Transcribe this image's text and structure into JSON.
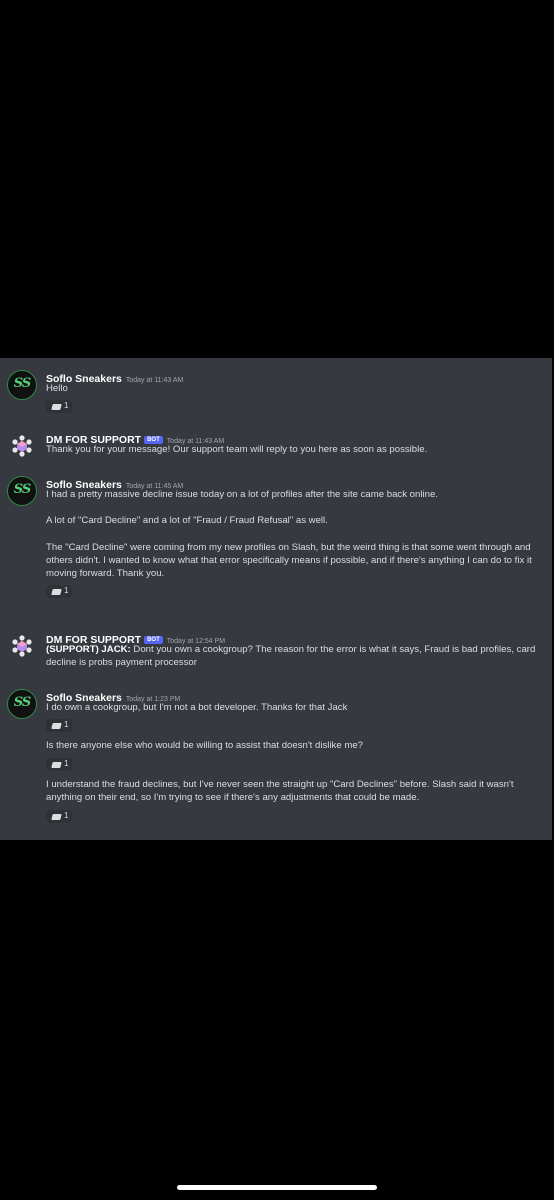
{
  "messages": [
    {
      "author": "Soflo Sneakers",
      "bot": false,
      "timestamp": "Today at 11:43 AM",
      "avatar_icon": "soflo-ss-logo",
      "paragraphs": [
        {
          "text": "Hello",
          "reaction": {
            "emoji": "ticket-icon",
            "count": "1"
          }
        }
      ]
    },
    {
      "author": "DM FOR SUPPORT",
      "bot": true,
      "badge": "BOT",
      "timestamp": "Today at 11:43 AM",
      "avatar_icon": "bot-cube-logo",
      "paragraphs": [
        {
          "text": "Thank you for your message! Our support team will reply to you here as soon as possible."
        }
      ]
    },
    {
      "author": "Soflo Sneakers",
      "bot": false,
      "timestamp": "Today at 11:45 AM",
      "avatar_icon": "soflo-ss-logo",
      "paragraphs": [
        {
          "text": "I had a pretty massive decline issue today on a lot of profiles after the site came back online."
        },
        {
          "text": "A lot of \"Card Decline\" and a lot of \"Fraud / Fraud Refusal\" as well."
        },
        {
          "text": "The \"Card Decline\" were coming from my new profiles on Slash, but the weird thing is that some went through and others didn't. I wanted to know what that error specifically means if possible, and if there's anything I can do to fix it moving forward. Thank you.",
          "reaction": {
            "emoji": "ticket-icon",
            "count": "1"
          }
        }
      ]
    },
    {
      "author": "DM FOR SUPPORT",
      "bot": true,
      "badge": "BOT",
      "timestamp": "Today at 12:54 PM",
      "avatar_icon": "bot-cube-logo",
      "paragraphs": [
        {
          "bold_prefix": "(SUPPORT) JACK:",
          "text": " Dont you own a cookgroup? The reason for the error is what it says, Fraud is bad profiles, card decline is probs payment processor"
        }
      ]
    },
    {
      "author": "Soflo Sneakers",
      "bot": false,
      "timestamp": "Today at 1:23 PM",
      "avatar_icon": "soflo-ss-logo",
      "paragraphs": [
        {
          "text": "I do own a cookgroup, but I'm not a bot developer. Thanks for that Jack",
          "reaction": {
            "emoji": "ticket-icon",
            "count": "1"
          }
        },
        {
          "text": "Is there anyone else who would be willing to assist that doesn't dislike me?",
          "reaction": {
            "emoji": "ticket-icon",
            "count": "1"
          }
        },
        {
          "text": "I understand the fraud declines, but I've never seen the straight up \"Card Declines\" before. Slash said it wasn't anything on their end, so I'm trying to see if there's any adjustments that could be made.",
          "reaction": {
            "emoji": "ticket-icon",
            "count": "1"
          }
        }
      ]
    }
  ],
  "avatar_text": "SS",
  "colors": {
    "chat_bg": "#36393f",
    "page_bg": "#000000",
    "bot_badge": "#5865f2",
    "soflo_green": "#58d07a",
    "text": "#dcddde",
    "timestamp": "#a3a6aa"
  }
}
